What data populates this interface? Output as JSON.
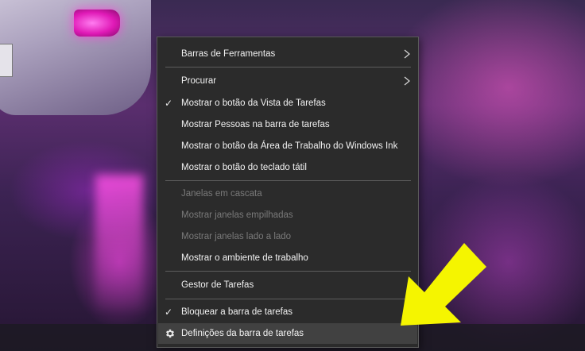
{
  "context_menu": {
    "items": [
      {
        "label": "Barras de Ferramentas",
        "submenu": true
      },
      {
        "label": "Procurar",
        "submenu": true
      },
      {
        "label": "Mostrar o botão da Vista de Tarefas",
        "checked": true
      },
      {
        "label": "Mostrar Pessoas na barra de tarefas"
      },
      {
        "label": "Mostrar o botão da Área de Trabalho do Windows Ink"
      },
      {
        "label": "Mostrar o botão do teclado tátil"
      },
      {
        "label": "Janelas em cascata",
        "disabled": true
      },
      {
        "label": "Mostrar janelas empilhadas",
        "disabled": true
      },
      {
        "label": "Mostrar janelas lado a lado",
        "disabled": true
      },
      {
        "label": "Mostrar o ambiente de trabalho"
      },
      {
        "label": "Gestor de Tarefas"
      },
      {
        "label": "Bloquear a barra de tarefas",
        "checked": true
      },
      {
        "label": "Definições da barra de tarefas",
        "icon": "gear-icon",
        "highlighted": true
      }
    ]
  },
  "colors": {
    "menu_background": "#2b2b2b",
    "menu_text": "#f2f2f2",
    "disabled_text": "#7a7a7a",
    "highlight": "#414141",
    "annotation_arrow": "#f5f500"
  },
  "annotation": {
    "icon": "arrow-pointer-icon"
  }
}
